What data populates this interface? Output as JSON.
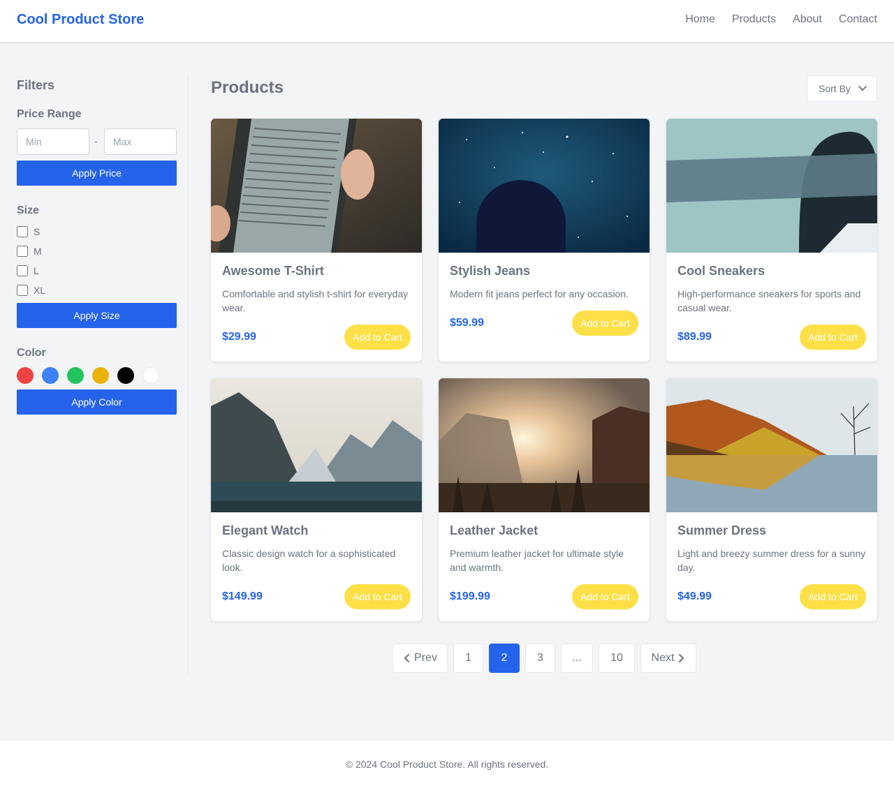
{
  "header": {
    "brand": "Cool Product Store",
    "nav": [
      "Home",
      "Products",
      "About",
      "Contact"
    ]
  },
  "filters": {
    "title": "Filters",
    "price_range": {
      "label": "Price Range",
      "min_placeholder": "Min",
      "max_placeholder": "Max",
      "separator": "-",
      "apply_label": "Apply Price"
    },
    "size": {
      "label": "Size",
      "options": [
        "S",
        "M",
        "L",
        "XL"
      ],
      "apply_label": "Apply Size"
    },
    "color": {
      "label": "Color",
      "swatches": [
        "#ef4444",
        "#3b82f6",
        "#22c55e",
        "#eab308",
        "#000000",
        "#ffffff"
      ],
      "apply_label": "Apply Color"
    }
  },
  "main": {
    "title": "Products",
    "sort_label": "Sort By",
    "add_to_cart_label": "Add to Cart",
    "products": [
      {
        "name": "Awesome T-Shirt",
        "description": "Comfortable and stylish t-shirt for everyday wear.",
        "price": "$29.99"
      },
      {
        "name": "Stylish Jeans",
        "description": "Modern fit jeans perfect for any occasion.",
        "price": "$59.99"
      },
      {
        "name": "Cool Sneakers",
        "description": "High-performance sneakers for sports and casual wear.",
        "price": "$89.99"
      },
      {
        "name": "Elegant Watch",
        "description": "Classic design watch for a sophisticated look.",
        "price": "$149.99"
      },
      {
        "name": "Leather Jacket",
        "description": "Premium leather jacket for ultimate style and warmth.",
        "price": "$199.99"
      },
      {
        "name": "Summer Dress",
        "description": "Light and breezy summer dress for a sunny day.",
        "price": "$49.99"
      }
    ]
  },
  "pagination": {
    "prev_label": "Prev",
    "next_label": "Next",
    "pages": [
      "1",
      "2",
      "3",
      "...",
      "10"
    ],
    "current": "2"
  },
  "footer": {
    "text": "© 2024 Cool Product Store. All rights reserved."
  },
  "colors": {
    "primary": "#2563eb",
    "accent": "#fde047"
  }
}
